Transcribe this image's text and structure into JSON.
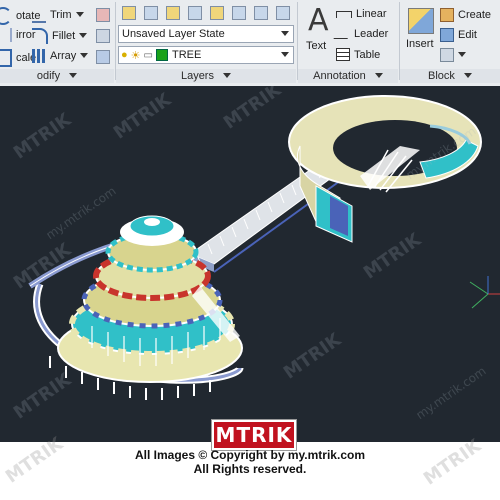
{
  "ribbon": {
    "modify": {
      "title": "odify",
      "items": [
        {
          "label": "otate",
          "icon": "rotate-icon"
        },
        {
          "label": "Trim",
          "icon": "trim-icon"
        },
        {
          "label": "irror",
          "icon": "mirror-icon"
        },
        {
          "label": "Fillet",
          "icon": "fillet-icon"
        },
        {
          "label": "cale",
          "icon": "scale-icon"
        },
        {
          "label": "Array",
          "icon": "array-icon"
        }
      ]
    },
    "layers": {
      "title": "Layers",
      "layer_state": "Unsaved Layer State",
      "current_layer": "TREE",
      "current_layer_color": "#1aa21a"
    },
    "annotation": {
      "title": "Annotation",
      "text_label": "Text",
      "text_icon_glyph": "A",
      "linear_label": "Linear",
      "leader_label": "Leader",
      "table_label": "Table"
    },
    "block": {
      "title": "Block",
      "insert_label": "Insert",
      "create_label": "Create",
      "edit_label": "Edit"
    }
  },
  "viewport": {
    "background": "#212830"
  },
  "footer": {
    "logo": "MTRIK",
    "copyright_line1": "All Images © Copyright by my.mtrik.com",
    "copyright_line2": "All Rights reserved."
  },
  "watermark": {
    "brand": "MTRIK",
    "site": "my.mtrik.com"
  },
  "colors": {
    "ribbon_bg": "#e9ecef",
    "accent_red": "#c1121f"
  }
}
